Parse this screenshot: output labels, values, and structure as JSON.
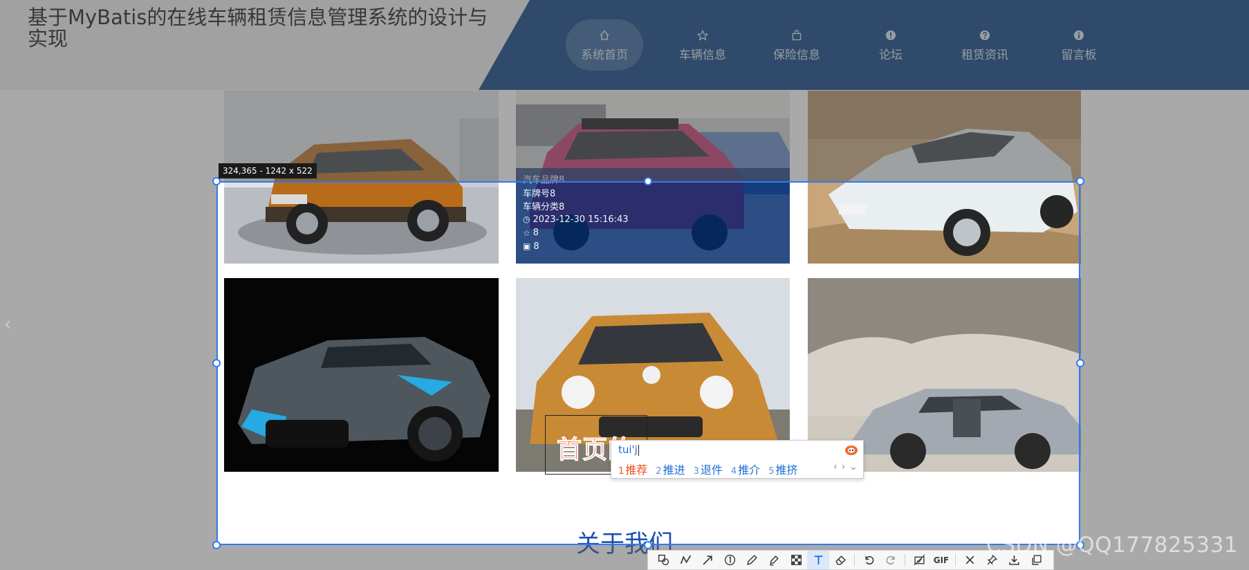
{
  "site": {
    "title": "基于MyBatis的在线车辆租赁信息管理系统的设计与实现"
  },
  "nav": {
    "items": [
      {
        "label": "系统首页",
        "icon": "home-icon",
        "active": true
      },
      {
        "label": "车辆信息",
        "icon": "star-icon",
        "active": false
      },
      {
        "label": "保险信息",
        "icon": "bag-icon",
        "active": false
      },
      {
        "label": "论坛",
        "icon": "exclamation-icon",
        "active": false
      },
      {
        "label": "租赁资讯",
        "icon": "question-icon",
        "active": false
      },
      {
        "label": "留言板",
        "icon": "info-icon",
        "active": false
      }
    ]
  },
  "cars": [
    {
      "name": "orange-suv",
      "body_color": "#b86c1a"
    },
    {
      "name": "red-sedan",
      "body_color": "#c2366b"
    },
    {
      "name": "white-sportback",
      "body_color": "#e9eef0"
    },
    {
      "name": "grey-hypercar",
      "body_color": "#4e565e"
    },
    {
      "name": "orange-beetle",
      "body_color": "#c98a35"
    },
    {
      "name": "silver-coupe",
      "body_color": "#a3a9b0"
    }
  ],
  "overlay": {
    "brand": "汽车品牌8",
    "plate": "车牌号8",
    "category": "车辆分类8",
    "time": "2023-12-30 15:16:43",
    "stars": "8",
    "views": "8"
  },
  "section": {
    "about_title": "关于我们"
  },
  "capture": {
    "size_label": "324,365 - 1242 x 522",
    "typed_text": "首页的"
  },
  "ime": {
    "composition": "tui'j",
    "candidates": [
      {
        "num": "1",
        "text": "推荐"
      },
      {
        "num": "2",
        "text": "推进"
      },
      {
        "num": "3",
        "text": "退件"
      },
      {
        "num": "4",
        "text": "推介"
      },
      {
        "num": "5",
        "text": "推挤"
      }
    ],
    "nav": [
      "‹",
      "›",
      "⌄"
    ]
  },
  "toolbar": {
    "tools": [
      "shape-icon",
      "polyline-icon",
      "arrow-icon",
      "number-icon",
      "pen-icon",
      "highlighter-icon",
      "mosaic-icon",
      "text-icon",
      "eraser-icon",
      "undo-icon",
      "redo-icon",
      "save-icon",
      "gif-icon",
      "close-icon",
      "pin-icon",
      "download-icon",
      "copy-icon"
    ],
    "gif_label": "GIF"
  },
  "watermark": "CSDN @QQ177825331",
  "colors": {
    "nav_band": "#003a7d",
    "selection": "#2f7bf0",
    "typed_text": "#ff2a1a",
    "ime_active": "#e8501d",
    "about": "#1a4fb5"
  }
}
